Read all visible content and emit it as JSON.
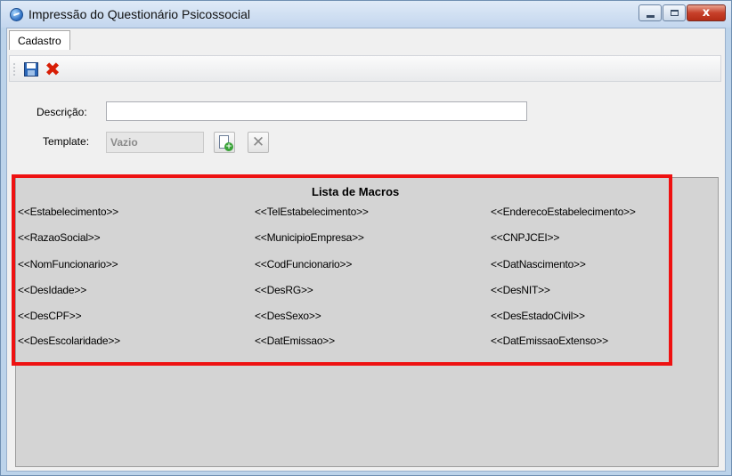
{
  "window": {
    "title": "Impressão do Questionário Psicossocial",
    "controls": {
      "minimize": "minimize",
      "maximize": "maximize",
      "close": "x"
    }
  },
  "tabs": [
    {
      "label": "Cadastro",
      "active": true
    }
  ],
  "toolbar": {
    "save_icon": "save-icon",
    "cancel_icon": "cancel-icon",
    "cancel_glyph": "✖"
  },
  "form": {
    "descricao_label": "Descrição:",
    "descricao_value": "",
    "template_label": "Template:",
    "template_value": "Vazio",
    "clear_glyph": "✕"
  },
  "macros": {
    "title": "Lista de Macros",
    "columns": [
      [
        "<<Estabelecimento>>",
        "<<RazaoSocial>>",
        "<<NomFuncionario>>",
        "<<DesIdade>>",
        "<<DesCPF>>",
        "<<DesEscolaridade>>"
      ],
      [
        "<<TelEstabelecimento>>",
        "<<MunicipioEmpresa>>",
        "<<CodFuncionario>>",
        "<<DesRG>>",
        "<<DesSexo>>",
        "<<DatEmissao>>"
      ],
      [
        "<<EnderecoEstabelecimento>>",
        "<<CNPJCEI>>",
        "<<DatNascimento>>",
        "<<DesNIT>>",
        "<<DesEstadoCivil>>",
        "<<DatEmissaoExtenso>>"
      ]
    ],
    "highlight_color": "#ee1111"
  }
}
